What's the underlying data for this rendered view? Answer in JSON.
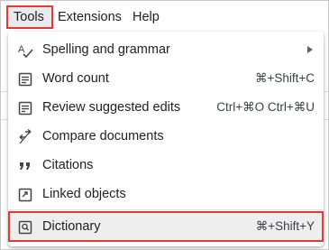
{
  "menubar": {
    "items": [
      {
        "label": "Tools"
      },
      {
        "label": "Extensions"
      },
      {
        "label": "Help"
      }
    ]
  },
  "tools_menu": {
    "items": [
      {
        "label": "Spelling and grammar",
        "shortcut": "",
        "icon": "spellcheck-icon",
        "has_submenu": true
      },
      {
        "label": "Word count",
        "shortcut": "⌘+Shift+C",
        "icon": "word-count-icon"
      },
      {
        "label": "Review suggested edits",
        "shortcut": "Ctrl+⌘O Ctrl+⌘U",
        "icon": "review-edits-icon"
      },
      {
        "label": "Compare documents",
        "shortcut": "",
        "icon": "compare-icon"
      },
      {
        "label": "Citations",
        "shortcut": "",
        "icon": "quote-icon"
      },
      {
        "label": "Linked objects",
        "shortcut": "",
        "icon": "link-icon"
      },
      {
        "label": "Dictionary",
        "shortcut": "⌘+Shift+Y",
        "icon": "dictionary-icon",
        "highlighted": true
      }
    ]
  },
  "colors": {
    "highlight_border": "#e53935",
    "hover_background": "#eeeeee",
    "text": "#202124",
    "icon": "#444746"
  }
}
